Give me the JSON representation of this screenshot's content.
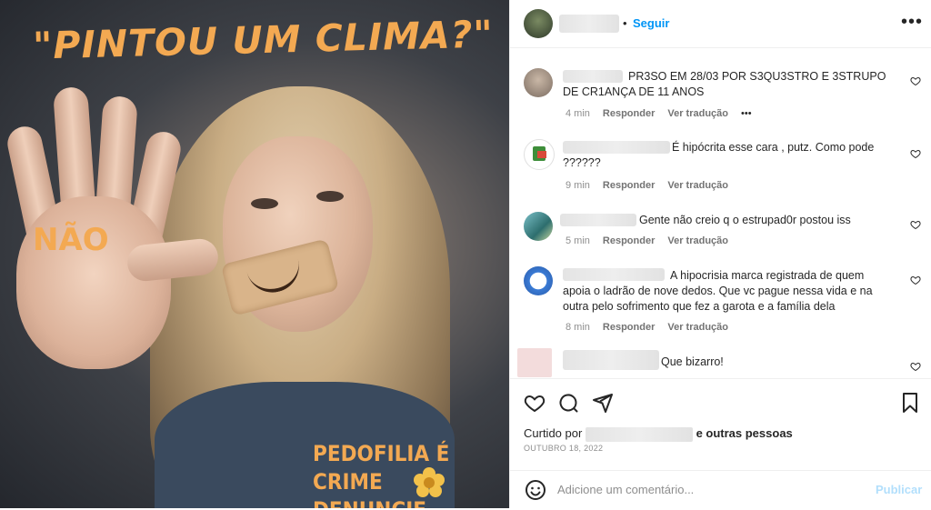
{
  "post_image": {
    "headline": "\"PINTOU UM CLIMA?\"",
    "hand_text": "NÃO",
    "footer_line1": "PEDOFILIA É CRIME",
    "footer_line2": "DENUNCIE."
  },
  "header": {
    "dot": "•",
    "follow_label": "Seguir",
    "more_label": "•••"
  },
  "comments": [
    {
      "text": "PR3SO EM 28/03 POR S3QU3STRO E 3STRUPO DE CR1ANÇA DE 11 ANOS",
      "time": "4 min",
      "reply": "Responder",
      "translate": "Ver tradução",
      "extra": "•••"
    },
    {
      "text": "É hipócrita esse cara , putz. Como pode ??????",
      "time": "9 min",
      "reply": "Responder",
      "translate": "Ver tradução"
    },
    {
      "text": "Gente não creio q o estrupad0r postou iss",
      "time": "5 min",
      "reply": "Responder",
      "translate": "Ver tradução"
    },
    {
      "text": "A hipocrisia marca registrada de quem apoia o ladrão de nove dedos. Que vc pague nessa vida e na outra pelo sofrimento que fez a garota e a família dela",
      "time": "8 min",
      "reply": "Responder",
      "translate": "Ver tradução"
    },
    {
      "text": "Que bizarro!"
    }
  ],
  "actions": {
    "liked_prefix": "Curtido por",
    "liked_suffix": "e outras pessoas",
    "date": "OUTUBRO 18, 2022",
    "comment_placeholder": "Adicione um comentário...",
    "publish_label": "Publicar"
  },
  "colors": {
    "accent": "#0095f6",
    "image_text": "#f3a952",
    "muted": "#8e8e8e"
  },
  "icons": [
    "heart-icon",
    "comment-icon",
    "share-icon",
    "bookmark-icon",
    "emoji-icon",
    "more-icon"
  ]
}
